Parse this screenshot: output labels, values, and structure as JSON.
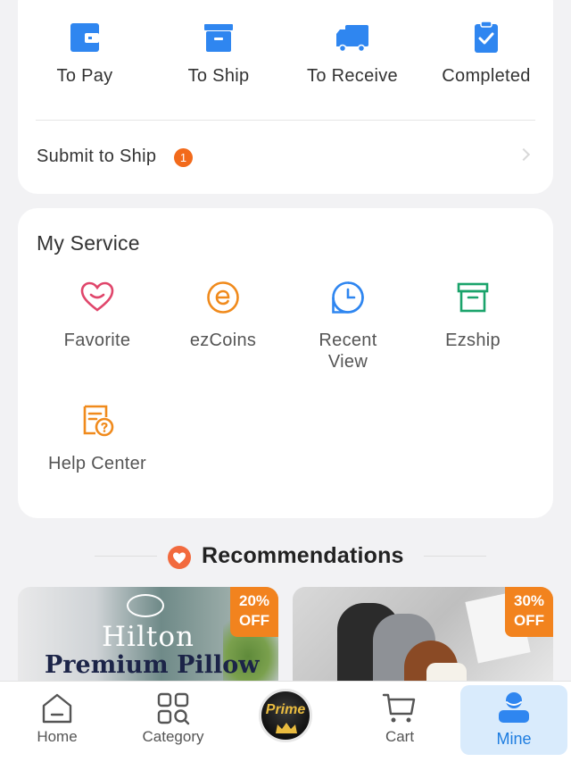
{
  "orders": {
    "items": [
      {
        "label": "To Pay",
        "icon": "wallet-icon"
      },
      {
        "label": "To Ship",
        "icon": "box-icon"
      },
      {
        "label": "To Receive",
        "icon": "truck-icon"
      },
      {
        "label": "Completed",
        "icon": "clipboard-check-icon"
      }
    ],
    "submit_label": "Submit to Ship",
    "submit_badge": "1"
  },
  "service": {
    "title": "My Service",
    "items": [
      {
        "label": "Favorite",
        "icon": "heart-icon"
      },
      {
        "label": "ezCoins",
        "icon": "coin-icon"
      },
      {
        "label": "Recent\nView",
        "icon": "clock-icon"
      },
      {
        "label": "Ezship",
        "icon": "archive-box-icon"
      },
      {
        "label": "Help Center",
        "icon": "help-document-icon"
      }
    ]
  },
  "recommendations": {
    "title": "Recommendations",
    "products": [
      {
        "discount": "20%\nOFF",
        "brand": "Hilton",
        "name": "Premium Pillow"
      },
      {
        "discount": "30%\nOFF"
      }
    ]
  },
  "tabbar": {
    "items": [
      {
        "label": "Home",
        "icon": "home-icon"
      },
      {
        "label": "Category",
        "icon": "category-grid-icon"
      },
      {
        "label": "Prime",
        "icon": "prime-crown-icon"
      },
      {
        "label": "Cart",
        "icon": "cart-icon"
      },
      {
        "label": "Mine",
        "icon": "user-icon",
        "active": true
      }
    ]
  },
  "colors": {
    "accent_blue": "#2f86f0",
    "active_tab_bg": "#d9ebfc",
    "badge_orange": "#f26a1b",
    "discount_orange": "#f2831e",
    "favorite_pink": "#e0466b",
    "coins_orange": "#f08a1c",
    "ezship_green": "#1aa36b"
  }
}
